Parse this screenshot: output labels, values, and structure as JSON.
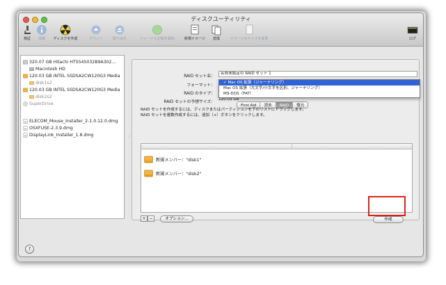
{
  "window": {
    "title": "ディスクユーティリティ"
  },
  "toolbar": {
    "items": [
      {
        "label": "検証",
        "icon": "microscope-icon"
      },
      {
        "label": "情報",
        "icon": "info-icon"
      },
      {
        "label": "ディスクを作成",
        "icon": "burn-icon"
      },
      {
        "label": "マウント",
        "icon": "mount-icon"
      },
      {
        "label": "取り出す",
        "icon": "eject-icon"
      },
      {
        "label": "ジャーナル記録を開始",
        "icon": "journal-icon"
      },
      {
        "label": "新規イメージ",
        "icon": "new-image-icon"
      },
      {
        "label": "変換",
        "icon": "convert-icon"
      },
      {
        "label": "イメージのサイズを変更",
        "icon": "resize-image-icon"
      },
      {
        "label": "ログ",
        "icon": "log-icon"
      }
    ]
  },
  "sidebar": {
    "items": [
      {
        "label": "320.07 GB Hitachi HTS545032B9A302...",
        "kind": "disk"
      },
      {
        "label": "Macintosh HD",
        "kind": "volume"
      },
      {
        "label": "120.03 GB INTEL SSDSA2CW120G3 Media",
        "kind": "disk"
      },
      {
        "label": "disk1s2",
        "kind": "volume-dim"
      },
      {
        "label": "120.03 GB INTEL SSDSA2CW120G3 Media",
        "kind": "disk"
      },
      {
        "label": "disk2s2",
        "kind": "volume-dim"
      },
      {
        "label": "SuperDrive",
        "kind": "optical"
      },
      {
        "label": "ELECOM_Mouse_Installer_2-1.0.12.0.dmg",
        "kind": "dmg"
      },
      {
        "label": "OSXFUSE-2.3.9.dmg",
        "kind": "dmg"
      },
      {
        "label": "DisplayLink_Installer_1.8.dmg",
        "kind": "dmg"
      }
    ]
  },
  "tabs": [
    {
      "label": "First Aid",
      "selected": false
    },
    {
      "label": "消去",
      "selected": false
    },
    {
      "label": "RAID",
      "selected": true
    },
    {
      "label": "復元",
      "selected": false
    }
  ],
  "raid": {
    "name_label": "RAID セット名：",
    "name_value": "名称未設定の RAID セット 1",
    "format_label": "フォーマット：",
    "type_label": "RAID のタイプ：",
    "size_label": "RAID セットの予想サイズ：",
    "size_value": "120.03 GB",
    "format_options": [
      {
        "label": "✓ Mac OS 拡張（ジャーナリング）",
        "selected": true
      },
      {
        "label": "Mac OS 拡張（大文字/小文字を区別、ジャーナリング）",
        "selected": false
      },
      {
        "label": "MS-DOS（FAT）",
        "selected": false
      }
    ],
    "info_line1": "RAID セットを作成するには、ディスクまたはパーティションを下のリストにドラッグします。",
    "info_line2": "RAID セットを複数作成するには、追加（+）ボタンをクリックします。",
    "members": [
      {
        "label": "新規メンバー：\"disk1\""
      },
      {
        "label": "新規メンバー：\"disk2\""
      }
    ],
    "add_label": "+",
    "remove_label": "−",
    "options_label": "オプション...",
    "create_label": "作成"
  },
  "help_label": "?",
  "colors": {
    "highlight": "#d9221c",
    "selection": "#2f63d4"
  }
}
